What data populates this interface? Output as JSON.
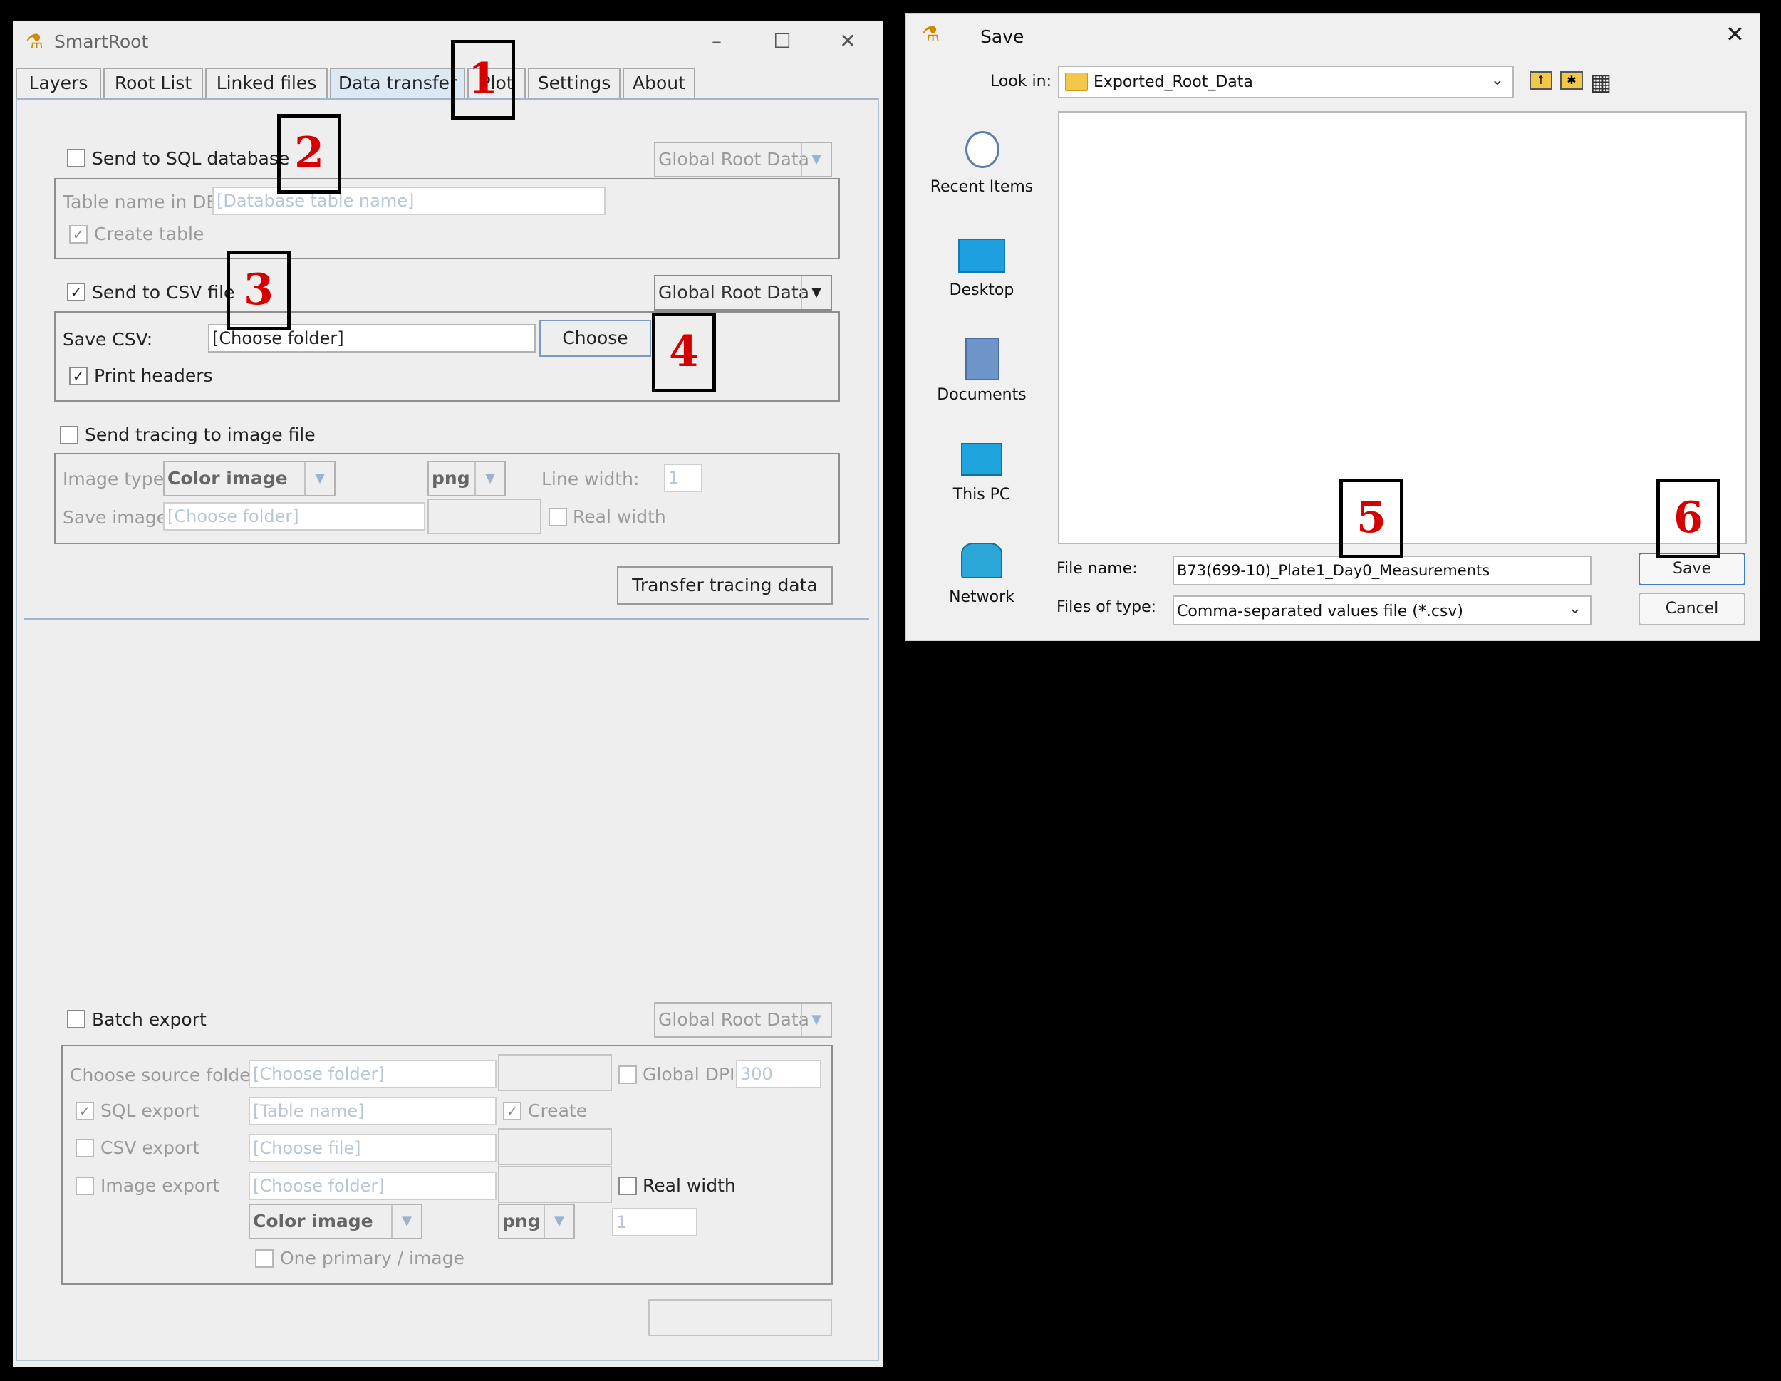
{
  "smartroot": {
    "title": "SmartRoot",
    "tabs": [
      "Layers",
      "Root List",
      "Linked files",
      "Data transfer",
      "Plot",
      "Settings",
      "About"
    ],
    "sql": {
      "label": "Send to SQL database",
      "scope": "Global Root Data",
      "table_label": "Table name in DB:",
      "table_placeholder": "[Database table name]",
      "create_table": "Create table"
    },
    "csv": {
      "label": "Send to CSV file",
      "scope": "Global Root Data",
      "save_label": "Save CSV:",
      "save_value": "[Choose folder]",
      "choose_button": "Choose",
      "print_headers": "Print headers"
    },
    "image": {
      "label": "Send tracing to image file",
      "type_label": "Image type:",
      "type_value": "Color image",
      "format_value": "png",
      "line_width_label": "Line width:",
      "line_width_value": "1",
      "save_label": "Save image:",
      "save_placeholder": "[Choose folder]",
      "real_width": "Real width"
    },
    "transfer_button": "Transfer tracing data",
    "batch": {
      "label": "Batch export",
      "scope": "Global Root Data",
      "source_label": "Choose source folder:",
      "source_placeholder": "[Choose folder]",
      "global_dpi_label": "Global DPI",
      "global_dpi_value": "300",
      "sql_label": "SQL export",
      "sql_placeholder": "[Table name]",
      "create_label": "Create",
      "csv_label": "CSV export",
      "csv_placeholder": "[Choose file]",
      "image_label": "Image export",
      "image_placeholder": "[Choose folder]",
      "real_width": "Real width",
      "type_value": "Color image",
      "format_value": "png",
      "width_value": "1",
      "one_primary": "One primary / image"
    }
  },
  "save_dialog": {
    "title": "Save",
    "look_in_label": "Look in:",
    "look_in_value": "Exported_Root_Data",
    "nav": [
      "Recent Items",
      "Desktop",
      "Documents",
      "This PC",
      "Network"
    ],
    "file_name_label": "File name:",
    "file_name_value": "B73(699-10)_Plate1_Day0_Measurements",
    "file_type_label": "Files of type:",
    "file_type_value": "Comma-separated values file (*.csv)",
    "save_button": "Save",
    "cancel_button": "Cancel"
  },
  "markers": [
    "1",
    "2",
    "3",
    "4",
    "5",
    "6"
  ],
  "colors": {
    "marker_text": "#d60000",
    "active_tab": "#dce8f4",
    "folder": "#f3c74a"
  }
}
